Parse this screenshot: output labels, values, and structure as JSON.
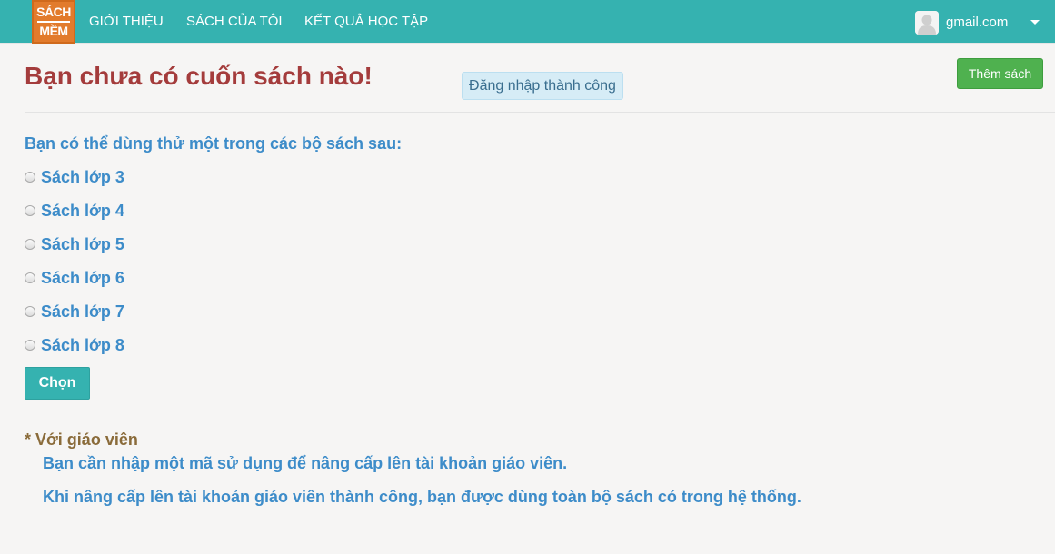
{
  "navbar": {
    "logo_top": "SÁCH",
    "logo_bottom": "MỀM",
    "links": [
      "GIỚI THIỆU",
      "SÁCH CỦA TÔI",
      "KẾT QUẢ HỌC TẬP"
    ],
    "user_email": "gmail.com",
    "avatar_icon": "user-avatar-icon",
    "caret_icon": "caret-down-icon",
    "color": "#35b2b0"
  },
  "main": {
    "title": "Bạn chưa có cuốn sách nào!",
    "alert": "Đăng nhập thành công",
    "add_button": "Thêm sách",
    "intro": "Bạn có thể dùng thử một trong các bộ sách sau:",
    "options": [
      "Sách lớp 3",
      "Sách lớp 4",
      "Sách lớp 5",
      "Sách lớp 6",
      "Sách lớp 7",
      "Sách lớp 8"
    ],
    "choose_button": "Chọn",
    "teacher": {
      "heading": "* Với giáo viên",
      "lines": [
        "Bạn cần nhập một mã sử dụng để nâng cấp lên tài khoản giáo viên.",
        "Khi nâng cấp lên tài khoản giáo viên thành công, bạn được dùng toàn bộ sách có trong hệ thống."
      ]
    }
  }
}
